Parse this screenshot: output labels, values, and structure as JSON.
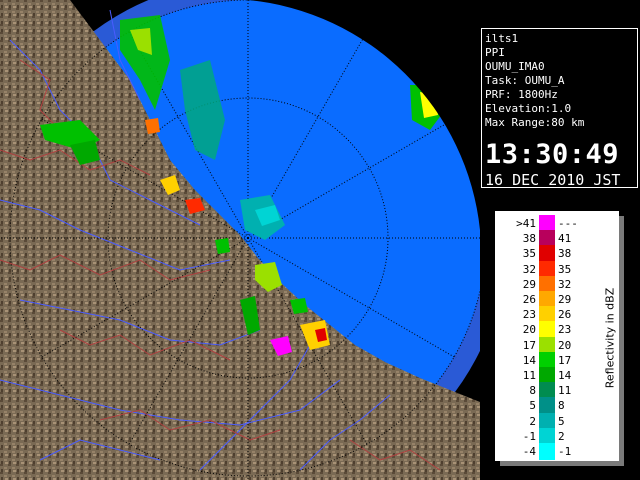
{
  "info_panel": {
    "site": "ilts1",
    "mode": "PPI",
    "product": "OUMU_IMA0",
    "task": "Task: OUMU_A",
    "prf": "PRF: 1800Hz",
    "elevation": "Elevation:1.0",
    "max_range": "Max Range:80 km",
    "time": "13:30:49",
    "date": "16 DEC 2010 JST"
  },
  "legend": {
    "unit_label": "Reflectivity in dBZ",
    "rows": [
      {
        "low": ">41",
        "high": "---",
        "color": "#ff00ff"
      },
      {
        "low": "38",
        "high": "41",
        "color": "#b8005c"
      },
      {
        "low": "35",
        "high": "38",
        "color": "#e00000"
      },
      {
        "low": "32",
        "high": "35",
        "color": "#ff2a00"
      },
      {
        "low": "29",
        "high": "32",
        "color": "#ff7000"
      },
      {
        "low": "26",
        "high": "29",
        "color": "#ffa800"
      },
      {
        "low": "23",
        "high": "26",
        "color": "#ffd000"
      },
      {
        "low": "20",
        "high": "23",
        "color": "#ffff00"
      },
      {
        "low": "17",
        "high": "20",
        "color": "#9be000"
      },
      {
        "low": "14",
        "high": "17",
        "color": "#00d000"
      },
      {
        "low": "11",
        "high": "14",
        "color": "#00a800"
      },
      {
        "low": "8",
        "high": "11",
        "color": "#008c50"
      },
      {
        "low": "5",
        "high": "8",
        "color": "#009088"
      },
      {
        "low": "2",
        "high": "5",
        "color": "#00b0b0"
      },
      {
        "low": "-1",
        "high": "2",
        "color": "#00d4d4"
      },
      {
        "low": "-4",
        "high": "-1",
        "color": "#00ffff"
      }
    ]
  },
  "colors": {
    "sea_outer": "#2a5ad6",
    "sea_inner": "#0a6cff",
    "land": "#7a6a54",
    "rivers": "#4a5cff",
    "boundaries": "#b04040",
    "range_rings": "#000000"
  }
}
